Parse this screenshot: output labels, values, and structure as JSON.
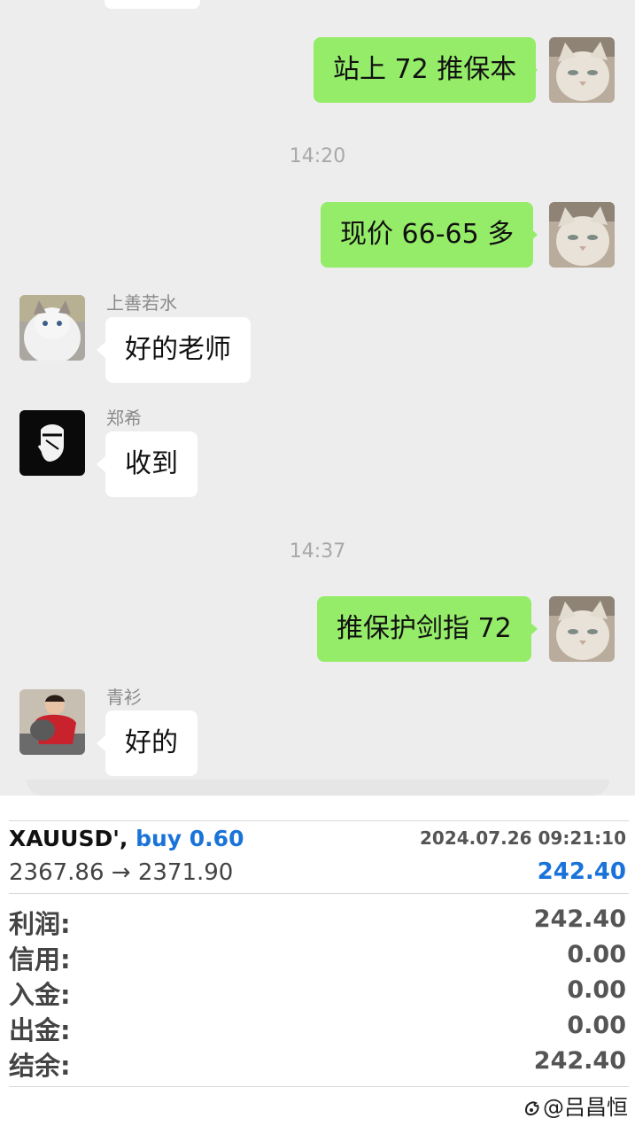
{
  "messages": {
    "m1": {
      "text": "站上 72 推保本"
    },
    "t1": "14:20",
    "m2": {
      "text": "现价 66-65 多"
    },
    "m3": {
      "sender": "上善若水",
      "text": "好的老师"
    },
    "m4": {
      "sender": "郑希",
      "text": "收到"
    },
    "t2": "14:37",
    "m5": {
      "text": "推保护剑指 72"
    },
    "m6": {
      "sender": "青衫",
      "text": "好的"
    }
  },
  "trade": {
    "symbol": "XAUUSD',",
    "side": "buy 0.60",
    "datetime": "2024.07.26 09:21:10",
    "price_move": "2367.86 → 2371.90",
    "profit_top": "242.40",
    "rows": [
      {
        "label": "利润:",
        "value": "242.40"
      },
      {
        "label": "信用:",
        "value": "0.00"
      },
      {
        "label": "入金:",
        "value": "0.00"
      },
      {
        "label": "出金:",
        "value": "0.00"
      },
      {
        "label": "结余:",
        "value": "242.40"
      }
    ]
  },
  "watermark": "@吕昌恒",
  "colors": {
    "outgoing_bubble": "#95ec69",
    "incoming_bubble": "#ffffff",
    "chat_bg": "#ededed",
    "accent_blue": "#1a73d9"
  },
  "icons": [
    "cat-avatar",
    "sketch-avatar",
    "child-avatar",
    "weibo-icon"
  ]
}
